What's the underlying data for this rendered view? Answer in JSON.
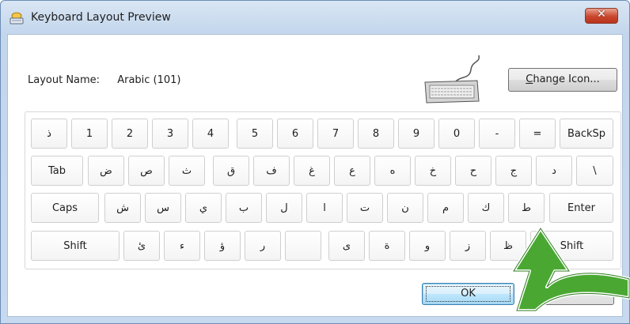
{
  "window": {
    "title": "Keyboard Layout Preview",
    "close_glyph": "✕"
  },
  "layout": {
    "label": "Layout Name:",
    "value": "Arabic (101)"
  },
  "buttons": {
    "change_icon_prefix": "C",
    "change_icon_rest": "hange Icon...",
    "ok": "OK"
  },
  "keyboard": {
    "rows": [
      [
        "ذ",
        "1",
        "2",
        "3",
        "4",
        "5",
        "6",
        "7",
        "8",
        "9",
        "0",
        "-",
        "=",
        "BackSp"
      ],
      [
        "Tab",
        "ض",
        "ص",
        "ث",
        "ق",
        "ف",
        "غ",
        "ع",
        "ه",
        "خ",
        "ح",
        "ج",
        "د",
        "\\"
      ],
      [
        "Caps",
        "ش",
        "س",
        "ي",
        "ب",
        "ل",
        "ا",
        "ت",
        "ن",
        "م",
        "ك",
        "ط",
        "Enter"
      ],
      [
        "Shift",
        "ئ",
        "ء",
        "ؤ",
        "ر",
        "",
        "ى",
        "ة",
        "و",
        "ز",
        "ظ",
        "Shift"
      ]
    ]
  },
  "colors": {
    "title_bg": "#c7d9ee",
    "close": "#c9462c",
    "ok_border": "#3c7fb1",
    "arrow": "#4aa832"
  },
  "icons": {
    "app": "keyboard-window-icon",
    "keyboard": "keyboard-image-icon",
    "arrow": "green-arrow-pointer-icon"
  }
}
